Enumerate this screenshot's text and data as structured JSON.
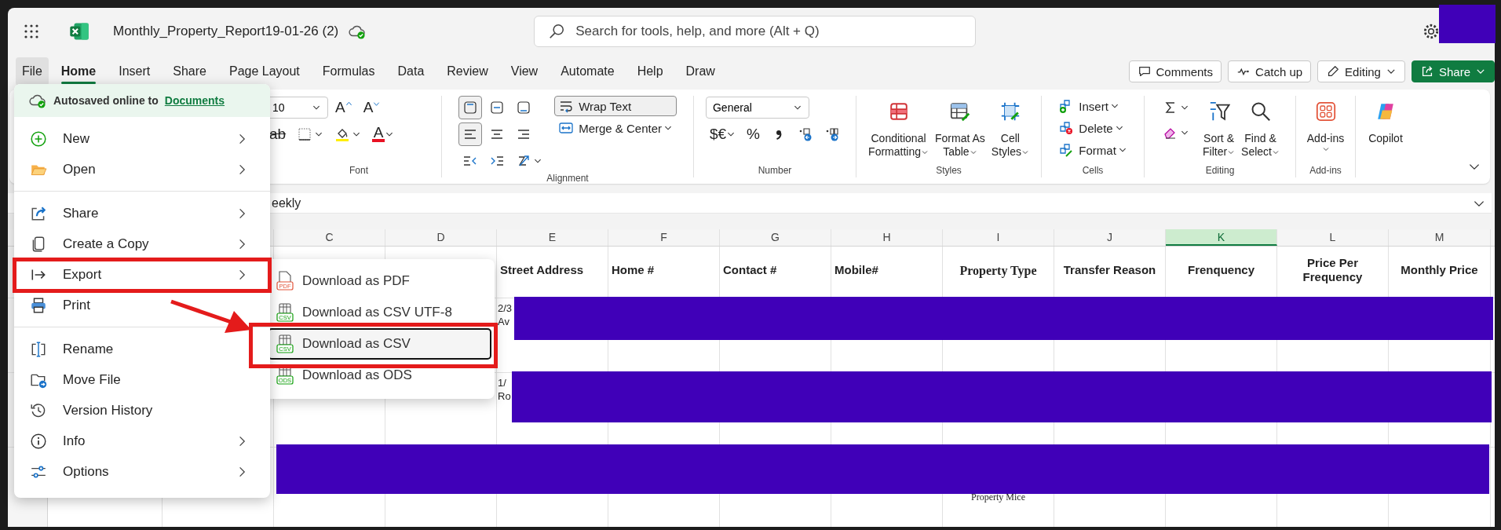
{
  "title_bar": {
    "document_title": "Monthly_Property_Report19-01-26 (2)",
    "search": {
      "placeholder": "Search for tools, help, and more (Alt + Q)"
    }
  },
  "tabs": [
    {
      "label": "File",
      "selected": false,
      "pressed": true
    },
    {
      "label": "Home",
      "selected": true,
      "pressed": false
    },
    {
      "label": "Insert",
      "selected": false,
      "pressed": false
    },
    {
      "label": "Share",
      "selected": false,
      "pressed": false
    },
    {
      "label": "Page Layout",
      "selected": false,
      "pressed": false
    },
    {
      "label": "Formulas",
      "selected": false,
      "pressed": false
    },
    {
      "label": "Data",
      "selected": false,
      "pressed": false
    },
    {
      "label": "Review",
      "selected": false,
      "pressed": false
    },
    {
      "label": "View",
      "selected": false,
      "pressed": false
    },
    {
      "label": "Automate",
      "selected": false,
      "pressed": false
    },
    {
      "label": "Help",
      "selected": false,
      "pressed": false
    },
    {
      "label": "Draw",
      "selected": false,
      "pressed": false
    }
  ],
  "header_buttons": [
    {
      "kind": "outline",
      "label": "Comments",
      "caret": false
    },
    {
      "kind": "outline",
      "label": "Catch up",
      "caret": false
    },
    {
      "kind": "outline",
      "label": "Editing",
      "caret": true
    },
    {
      "kind": "primary",
      "label": "Share",
      "caret": true
    }
  ],
  "ribbon": {
    "groups": [
      {
        "label": "Font",
        "sections": [
          {
            "kind": "rows",
            "rows": [
              [
                {
                  "kind": "dropdown",
                  "text": "10"
                },
                {
                  "kind": "grow",
                  "text": "A"
                },
                {
                  "kind": "shrink",
                  "text": "A"
                }
              ],
              [
                {
                  "kind": "strike",
                  "text": "ab"
                },
                {
                  "kind": "icon",
                  "caret": true
                },
                {
                  "kind": "icon",
                  "caret": true
                },
                {
                  "kind": "fontcolor",
                  "text": "A",
                  "caret": true
                }
              ]
            ]
          }
        ]
      },
      {
        "label": "Alignment",
        "sections": [
          {
            "kind": "rows",
            "rows": [
              [
                {
                  "kind": "toggle",
                  "selected": true
                },
                {
                  "kind": "toggle",
                  "selected": false
                },
                {
                  "kind": "toggle",
                  "selected": false
                }
              ],
              [
                {
                  "kind": "toggle",
                  "selected": true
                },
                {
                  "kind": "toggle",
                  "selected": false
                },
                {
                  "kind": "toggle",
                  "selected": false
                }
              ],
              [
                {
                  "kind": "icon",
                  "caret": false
                },
                {
                  "kind": "icon",
                  "caret": false
                },
                {
                  "kind": "icon",
                  "caret": true
                }
              ]
            ]
          },
          {
            "kind": "stack",
            "items": [
              {
                "kind": "small",
                "text": "Wrap Text",
                "selected": true,
                "caret": false
              },
              {
                "kind": "small",
                "text": "Merge & Center",
                "caret": true,
                "selected": false
              }
            ]
          }
        ]
      },
      {
        "label": "Number",
        "sections": [
          {
            "kind": "rows",
            "rows": [
              [
                {
                  "kind": "dropdown",
                  "text": "General"
                }
              ],
              [
                {
                  "kind": "glyph",
                  "text": "$€",
                  "caret": true
                },
                {
                  "kind": "glyph",
                  "text": "%",
                  "caret": false
                },
                {
                  "kind": "icon",
                  "caret": false
                },
                {
                  "kind": "icon",
                  "caret": false
                },
                {
                  "kind": "icon",
                  "caret": false
                }
              ]
            ]
          }
        ]
      },
      {
        "label": "Styles",
        "sections": [
          {
            "kind": "big",
            "items": [
              {
                "lines": [
                  "Conditional",
                  "Formatting"
                ],
                "caret": true
              },
              {
                "lines": [
                  "Format As",
                  "Table"
                ],
                "caret": true
              },
              {
                "lines": [
                  "Cell",
                  "Styles"
                ],
                "caret": true
              }
            ]
          }
        ]
      },
      {
        "label": "Cells",
        "sections": [
          {
            "kind": "stack",
            "items": [
              {
                "kind": "small",
                "text": "Insert",
                "caret": true
              },
              {
                "kind": "small",
                "text": "Delete",
                "caret": true
              },
              {
                "kind": "small",
                "text": "Format",
                "caret": true
              }
            ]
          }
        ]
      },
      {
        "label": "Editing",
        "sections": [
          {
            "kind": "stack",
            "items": [
              {
                "kind": "icon",
                "caret": true
              },
              {
                "kind": "icon",
                "caret": true
              }
            ]
          },
          {
            "kind": "big",
            "items": [
              {
                "lines": [
                  "Sort &",
                  "Filter"
                ],
                "caret": true
              },
              {
                "lines": [
                  "Find &",
                  "Select"
                ],
                "caret": true
              }
            ]
          }
        ]
      },
      {
        "label": "Add-ins",
        "sections": [
          {
            "kind": "big",
            "items": [
              {
                "lines": [
                  "Add-ins"
                ],
                "caret": true
              }
            ]
          }
        ]
      },
      {
        "sections": [
          {
            "kind": "big",
            "items": [
              {
                "lines": [
                  "Copilot"
                ],
                "caret": false
              }
            ]
          }
        ]
      }
    ]
  },
  "formula_bar": {
    "value": "eekly"
  },
  "grid": {
    "columns": [
      {
        "letter": "C",
        "selected": false
      },
      {
        "letter": "D",
        "selected": false
      },
      {
        "letter": "E",
        "selected": false
      },
      {
        "letter": "F",
        "selected": false
      },
      {
        "letter": "G",
        "selected": false
      },
      {
        "letter": "H",
        "selected": false
      },
      {
        "letter": "I",
        "selected": false
      },
      {
        "letter": "J",
        "selected": false
      },
      {
        "letter": "K",
        "selected": true
      },
      {
        "letter": "L",
        "selected": false
      },
      {
        "letter": "M",
        "selected": false
      }
    ],
    "rows": [
      {
        "cells": [
          "",
          "",
          "Street Address",
          "Home #",
          "Contact #",
          "Mobile#",
          "Property Type",
          "Transfer Reason",
          "Frenquency",
          "Price Per Frequency",
          "Monthly Price"
        ]
      },
      {
        "cells": [
          "",
          "",
          "2/3\nAv"
        ]
      },
      {
        "cells": [
          "",
          "",
          "1/\nRo"
        ]
      },
      {
        "cells": [
          "",
          "",
          "",
          "",
          "",
          "",
          "Property Mice"
        ]
      }
    ]
  },
  "file_menu": {
    "header": {
      "text": "Autosaved online to",
      "link": "Documents"
    },
    "groups": [
      [
        {
          "label": "New",
          "has_submenu": true
        },
        {
          "label": "Open",
          "has_submenu": true
        }
      ],
      [
        {
          "label": "Share",
          "has_submenu": true
        },
        {
          "label": "Create a Copy",
          "has_submenu": true
        },
        {
          "label": "Export",
          "has_submenu": true
        },
        {
          "label": "Print",
          "has_submenu": false
        }
      ],
      [
        {
          "label": "Rename",
          "has_submenu": false
        },
        {
          "label": "Move File",
          "has_submenu": false
        },
        {
          "label": "Version History",
          "has_submenu": false
        },
        {
          "label": "Info",
          "has_submenu": true
        },
        {
          "label": "Options",
          "has_submenu": true
        }
      ]
    ]
  },
  "export_submenu": {
    "items": [
      {
        "label": "Download as PDF",
        "kind": "pdf",
        "icon_label": "PDF",
        "selected": false
      },
      {
        "label": "Download as CSV UTF-8",
        "kind": "sheet",
        "icon_label": "CSV",
        "selected": false
      },
      {
        "label": "Download as CSV",
        "kind": "sheet",
        "icon_label": "CSV",
        "selected": true
      },
      {
        "label": "Download as ODS",
        "kind": "sheet",
        "icon_label": "ODS",
        "selected": false
      }
    ]
  }
}
